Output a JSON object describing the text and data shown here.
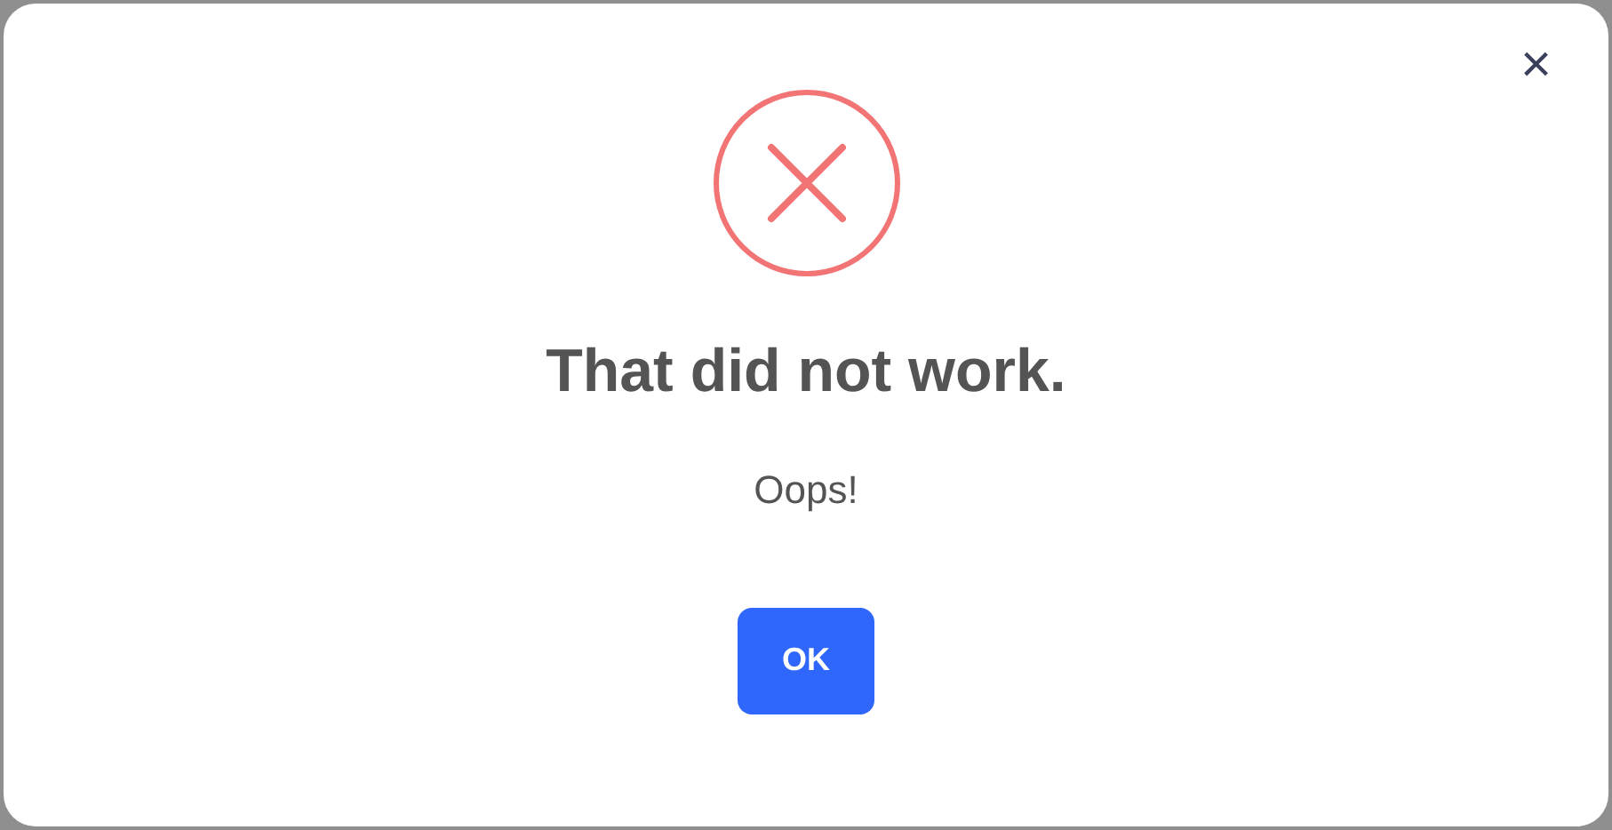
{
  "dialog": {
    "close": "×",
    "title": "That did not work.",
    "message": "Oops!",
    "buttons": [
      "OK"
    ]
  }
}
